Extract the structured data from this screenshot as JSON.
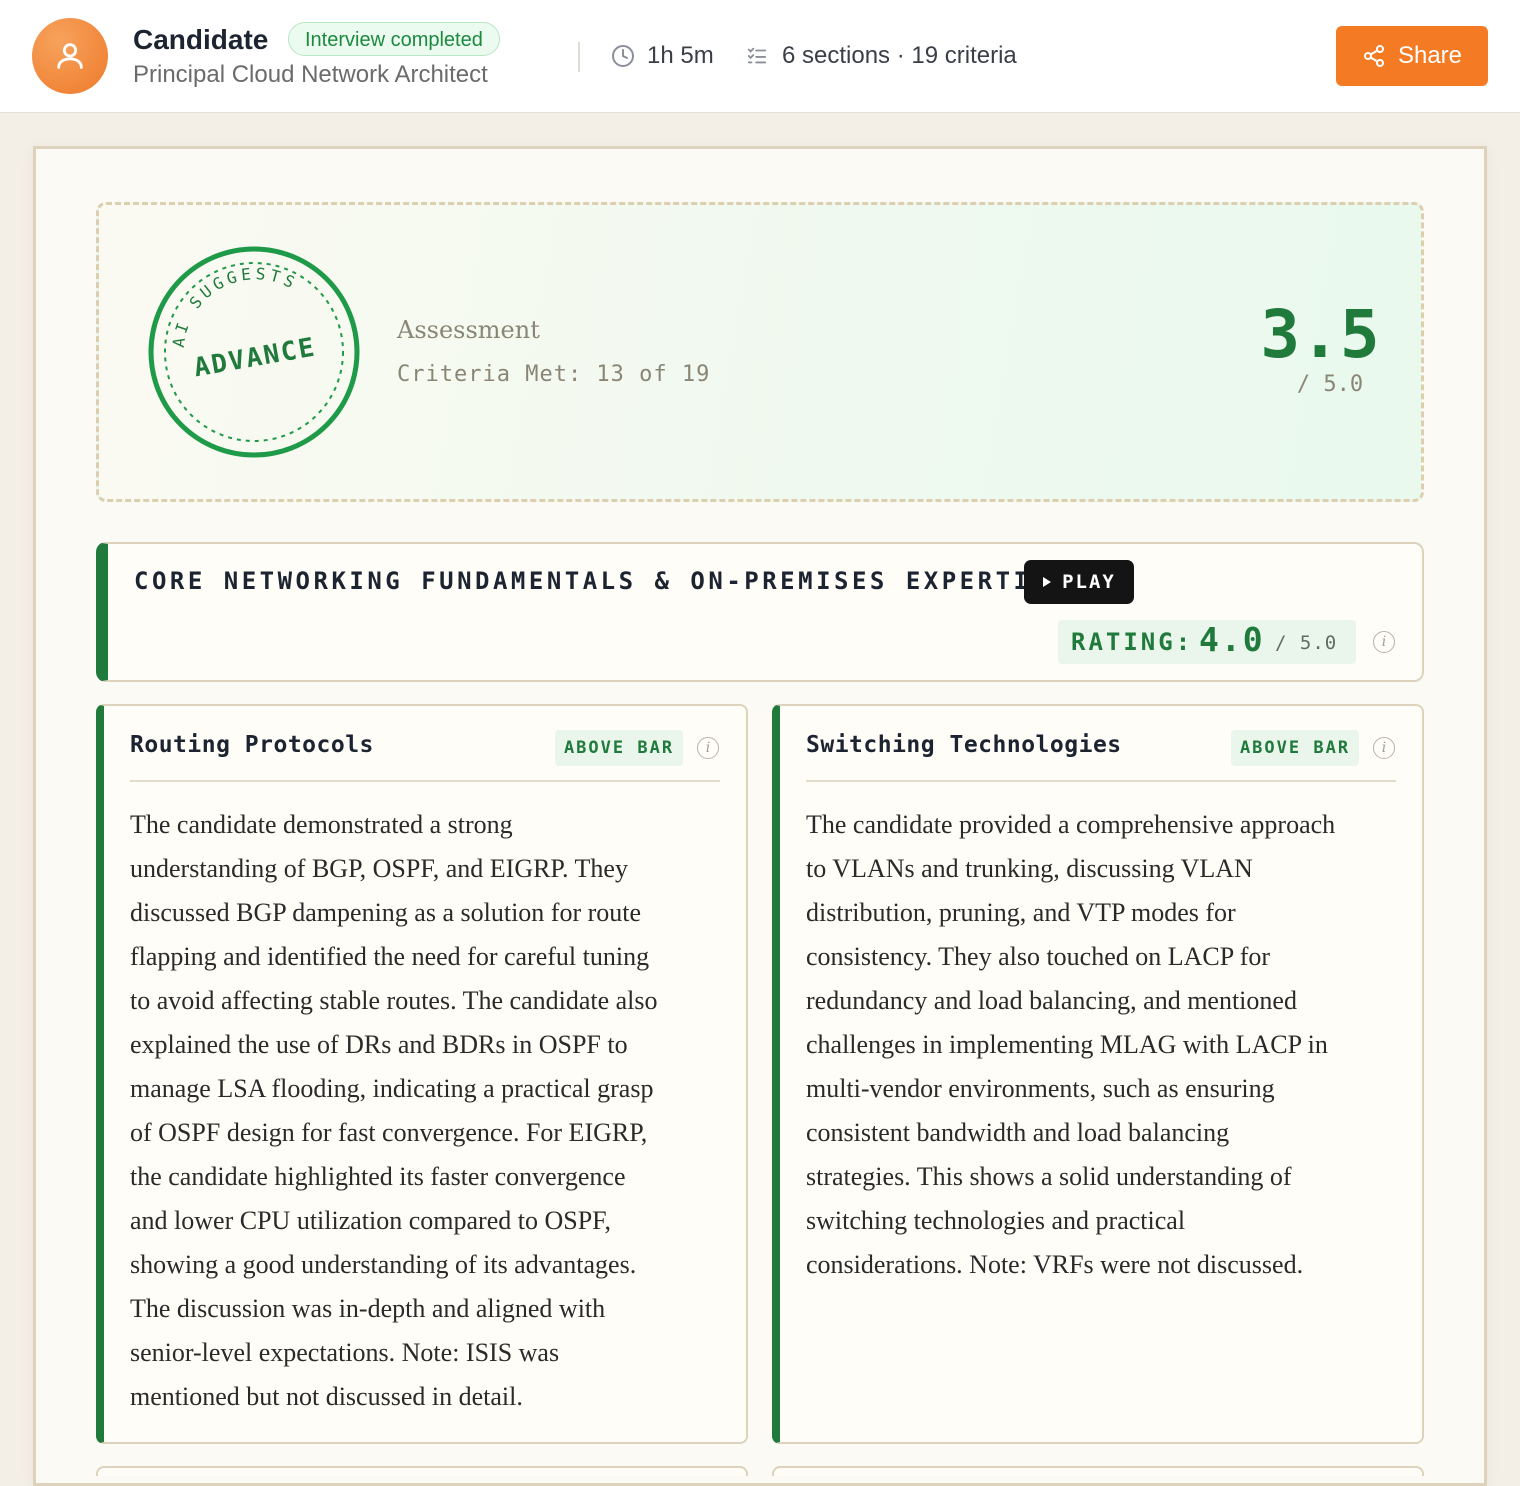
{
  "header": {
    "candidate_name": "Candidate",
    "status": "Interview completed",
    "role": "Principal Cloud Network Architect",
    "duration": "1h 5m",
    "sections_summary": "6 sections · 19 criteria",
    "share_label": "Share",
    "accent_color": "#f47b24",
    "icons": {
      "avatar": "user-icon",
      "duration": "clock-icon",
      "sections": "checklist-icon",
      "share": "share-icon"
    }
  },
  "assessment": {
    "stamp_top": "AI SUGGESTS",
    "stamp_main": "ADVANCE",
    "label": "Assessment",
    "criteria_met": "Criteria Met: 13 of 19",
    "score": "3.5",
    "score_max": "/ 5.0",
    "accent_color": "#1f7a3c"
  },
  "section": {
    "title": "CORE NETWORKING FUNDAMENTALS & ON-PREMISES EXPERTISE",
    "play_label": "PLAY",
    "rating_label": "RATING:",
    "rating_value": "4.0",
    "rating_max": "/ 5.0"
  },
  "criteria": [
    {
      "title": "Routing Protocols",
      "badge": "ABOVE BAR",
      "lines": [
        "The candidate demonstrated a strong",
        "understanding of BGP, OSPF, and EIGRP. They",
        "discussed BGP dampening as a solution for route",
        "flapping and identified the need for careful tuning",
        "to avoid affecting stable routes. The candidate also",
        "explained the use of DRs and BDRs in OSPF to",
        "manage LSA flooding, indicating a practical grasp",
        "of OSPF design for fast convergence. For EIGRP,",
        "the candidate highlighted its faster convergence",
        "and lower CPU utilization compared to OSPF,",
        "showing a good understanding of its advantages.",
        "The discussion was in-depth and aligned with",
        "senior-level expectations. Note: ISIS was",
        "mentioned but not discussed in detail."
      ]
    },
    {
      "title": "Switching Technologies",
      "badge": "ABOVE BAR",
      "lines": [
        "The candidate provided a comprehensive approach",
        "to VLANs and trunking, discussing VLAN",
        "distribution, pruning, and VTP modes for",
        "consistency. They also touched on LACP for",
        "redundancy and load balancing, and mentioned",
        "challenges in implementing MLAG with LACP in",
        "multi-vendor environments, such as ensuring",
        "consistent bandwidth and load balancing",
        "strategies. This shows a solid understanding of",
        "switching technologies and practical",
        "considerations. Note: VRFs were not discussed."
      ]
    }
  ]
}
